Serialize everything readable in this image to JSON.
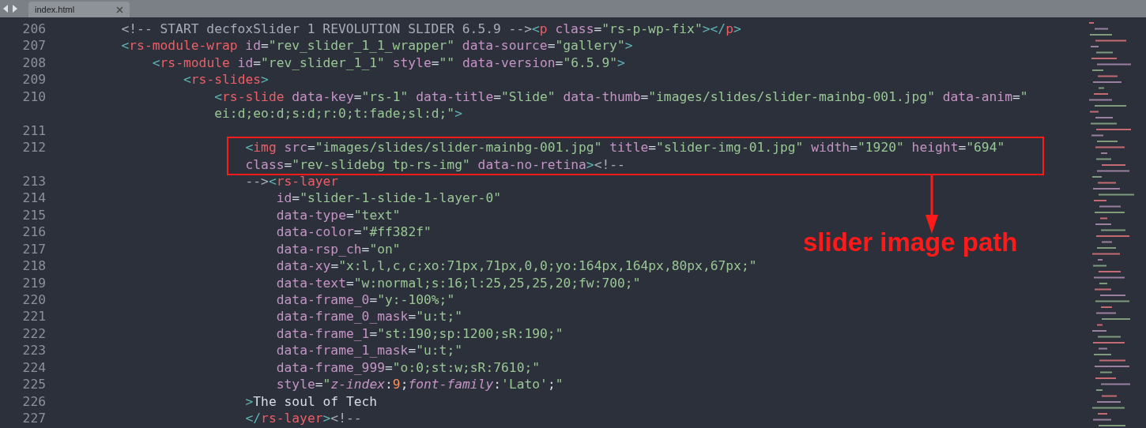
{
  "tabs": [
    {
      "label": "index.html",
      "selected": true
    }
  ],
  "lines": [
    {
      "number": "206",
      "tokens": [
        {
          "kind": "comment",
          "text": "<!-- START decfoxSlider 1 REVOLUTION SLIDER 6.5.9 -->"
        },
        {
          "kind": "punct",
          "text": "<"
        },
        {
          "kind": "tag",
          "text": "p"
        },
        {
          "kind": "attr",
          "text": " class"
        },
        {
          "kind": "plain",
          "text": "="
        },
        {
          "kind": "string",
          "text": "\"rs-p-wp-fix\""
        },
        {
          "kind": "punct",
          "text": "></"
        },
        {
          "kind": "tag",
          "text": "p"
        },
        {
          "kind": "punct",
          "text": ">"
        }
      ]
    },
    {
      "number": "207",
      "tokens": [
        {
          "kind": "punct",
          "text": "<"
        },
        {
          "kind": "tag",
          "text": "rs-module-wrap"
        },
        {
          "kind": "attr",
          "text": " id"
        },
        {
          "kind": "plain",
          "text": "="
        },
        {
          "kind": "string",
          "text": "\"rev_slider_1_1_wrapper\""
        },
        {
          "kind": "attr",
          "text": " data-source"
        },
        {
          "kind": "plain",
          "text": "="
        },
        {
          "kind": "string",
          "text": "\"gallery\""
        },
        {
          "kind": "punct",
          "text": ">"
        }
      ],
      "children": [
        {
          "number": "208",
          "tokens": [
            {
              "kind": "punct",
              "text": "<"
            },
            {
              "kind": "tag",
              "text": "rs-module"
            },
            {
              "kind": "attr",
              "text": " id"
            },
            {
              "kind": "plain",
              "text": "="
            },
            {
              "kind": "string",
              "text": "\"rev_slider_1_1\""
            },
            {
              "kind": "attr",
              "text": " style"
            },
            {
              "kind": "plain",
              "text": "="
            },
            {
              "kind": "string",
              "text": "\"\""
            },
            {
              "kind": "attr",
              "text": " data-version"
            },
            {
              "kind": "plain",
              "text": "="
            },
            {
              "kind": "string",
              "text": "\"6.5.9\""
            },
            {
              "kind": "punct",
              "text": ">"
            }
          ],
          "children": [
            {
              "number": "209",
              "tokens": [
                {
                  "kind": "punct",
                  "text": "<"
                },
                {
                  "kind": "tag",
                  "text": "rs-slides"
                },
                {
                  "kind": "punct",
                  "text": ">"
                }
              ],
              "children": [
                {
                  "number": "210",
                  "tokens": [
                    {
                      "kind": "punct",
                      "text": "<"
                    },
                    {
                      "kind": "tag",
                      "text": "rs-slide"
                    },
                    {
                      "kind": "attr",
                      "text": " data-key"
                    },
                    {
                      "kind": "plain",
                      "text": "="
                    },
                    {
                      "kind": "string",
                      "text": "\"rs-1\""
                    },
                    {
                      "kind": "attr",
                      "text": " data-title"
                    },
                    {
                      "kind": "plain",
                      "text": "="
                    },
                    {
                      "kind": "string",
                      "text": "\"Slide\""
                    },
                    {
                      "kind": "attr",
                      "text": " data-thumb"
                    },
                    {
                      "kind": "plain",
                      "text": "="
                    },
                    {
                      "kind": "string",
                      "text": "\"images/slides/slider-mainbg-001.jpg\""
                    },
                    {
                      "kind": "attr",
                      "text": " data-anim"
                    },
                    {
                      "kind": "plain",
                      "text": "="
                    },
                    {
                      "kind": "string",
                      "text": "\""
                    }
                  ],
                  "wrap": [
                    {
                      "kind": "string",
                      "text": "ei:d;eo:d;s:d;r:0;t:fade;sl:d;\""
                    },
                    {
                      "kind": "punct",
                      "text": ">"
                    }
                  ],
                  "children": [
                    {
                      "number": "211"
                    },
                    {
                      "number": "212",
                      "tokens": [
                        {
                          "kind": "punct",
                          "text": "<"
                        },
                        {
                          "kind": "tag",
                          "text": "img"
                        },
                        {
                          "kind": "attr",
                          "text": " src"
                        },
                        {
                          "kind": "plain",
                          "text": "="
                        },
                        {
                          "kind": "string",
                          "text": "\"images/slides/slider-mainbg-001.jpg\""
                        },
                        {
                          "kind": "attr",
                          "text": " title"
                        },
                        {
                          "kind": "plain",
                          "text": "="
                        },
                        {
                          "kind": "string",
                          "text": "\"slider-img-01.jpg\""
                        },
                        {
                          "kind": "attr",
                          "text": " width"
                        },
                        {
                          "kind": "plain",
                          "text": "="
                        },
                        {
                          "kind": "string",
                          "text": "\"1920\""
                        },
                        {
                          "kind": "attr",
                          "text": " height"
                        },
                        {
                          "kind": "plain",
                          "text": "="
                        },
                        {
                          "kind": "string",
                          "text": "\"694\""
                        }
                      ],
                      "wrap": [
                        {
                          "kind": "attr",
                          "text": "class"
                        },
                        {
                          "kind": "plain",
                          "text": "="
                        },
                        {
                          "kind": "string",
                          "text": "\"rev-slidebg tp-rs-img\""
                        },
                        {
                          "kind": "attr",
                          "text": " data-no-retina"
                        },
                        {
                          "kind": "punct",
                          "text": ">"
                        },
                        {
                          "kind": "comment",
                          "text": "<!--"
                        }
                      ]
                    },
                    {
                      "number": "213",
                      "tokens": [
                        {
                          "kind": "comment",
                          "text": "-->"
                        },
                        {
                          "kind": "punct",
                          "text": "<"
                        },
                        {
                          "kind": "tag",
                          "text": "rs-layer"
                        }
                      ],
                      "children": [
                        {
                          "number": "214",
                          "tokens": [
                            {
                              "kind": "attr",
                              "text": "id"
                            },
                            {
                              "kind": "plain",
                              "text": "="
                            },
                            {
                              "kind": "string",
                              "text": "\"slider-1-slide-1-layer-0\""
                            }
                          ]
                        },
                        {
                          "number": "215",
                          "tokens": [
                            {
                              "kind": "attr",
                              "text": "data-type"
                            },
                            {
                              "kind": "plain",
                              "text": "="
                            },
                            {
                              "kind": "string",
                              "text": "\"text\""
                            }
                          ]
                        },
                        {
                          "number": "216",
                          "tokens": [
                            {
                              "kind": "attr",
                              "text": "data-color"
                            },
                            {
                              "kind": "plain",
                              "text": "="
                            },
                            {
                              "kind": "string",
                              "text": "\"#ff382f\""
                            }
                          ]
                        },
                        {
                          "number": "217",
                          "tokens": [
                            {
                              "kind": "attr",
                              "text": "data-rsp_ch"
                            },
                            {
                              "kind": "plain",
                              "text": "="
                            },
                            {
                              "kind": "string",
                              "text": "\"on\""
                            }
                          ]
                        },
                        {
                          "number": "218",
                          "tokens": [
                            {
                              "kind": "attr",
                              "text": "data-xy"
                            },
                            {
                              "kind": "plain",
                              "text": "="
                            },
                            {
                              "kind": "string",
                              "text": "\"x:l,l,c,c;xo:71px,71px,0,0;yo:164px,164px,80px,67px;\""
                            }
                          ]
                        },
                        {
                          "number": "219",
                          "tokens": [
                            {
                              "kind": "attr",
                              "text": "data-text"
                            },
                            {
                              "kind": "plain",
                              "text": "="
                            },
                            {
                              "kind": "string",
                              "text": "\"w:normal;s:16;l:25,25,25,20;fw:700;\""
                            }
                          ]
                        },
                        {
                          "number": "220",
                          "tokens": [
                            {
                              "kind": "attr",
                              "text": "data-frame_0"
                            },
                            {
                              "kind": "plain",
                              "text": "="
                            },
                            {
                              "kind": "string",
                              "text": "\"y:-100%;\""
                            }
                          ]
                        },
                        {
                          "number": "221",
                          "tokens": [
                            {
                              "kind": "attr",
                              "text": "data-frame_0_mask"
                            },
                            {
                              "kind": "plain",
                              "text": "="
                            },
                            {
                              "kind": "string",
                              "text": "\"u:t;\""
                            }
                          ]
                        },
                        {
                          "number": "222",
                          "tokens": [
                            {
                              "kind": "attr",
                              "text": "data-frame_1"
                            },
                            {
                              "kind": "plain",
                              "text": "="
                            },
                            {
                              "kind": "string",
                              "text": "\"st:190;sp:1200;sR:190;\""
                            }
                          ]
                        },
                        {
                          "number": "223",
                          "tokens": [
                            {
                              "kind": "attr",
                              "text": "data-frame_1_mask"
                            },
                            {
                              "kind": "plain",
                              "text": "="
                            },
                            {
                              "kind": "string",
                              "text": "\"u:t;\""
                            }
                          ]
                        },
                        {
                          "number": "224",
                          "tokens": [
                            {
                              "kind": "attr",
                              "text": "data-frame_999"
                            },
                            {
                              "kind": "plain",
                              "text": "="
                            },
                            {
                              "kind": "string",
                              "text": "\"o:0;st:w;sR:7610;\""
                            }
                          ]
                        },
                        {
                          "number": "225",
                          "tokens": [
                            {
                              "kind": "attr",
                              "text": "style"
                            },
                            {
                              "kind": "plain",
                              "text": "="
                            },
                            {
                              "kind": "string",
                              "text": "\""
                            },
                            {
                              "kind": "prop",
                              "text": "z-index"
                            },
                            {
                              "kind": "plain",
                              "text": ":"
                            },
                            {
                              "kind": "number",
                              "text": "9"
                            },
                            {
                              "kind": "plain",
                              "text": ";"
                            },
                            {
                              "kind": "prop",
                              "text": "font-family"
                            },
                            {
                              "kind": "plain",
                              "text": ":"
                            },
                            {
                              "kind": "string",
                              "text": "'Lato'"
                            },
                            {
                              "kind": "plain",
                              "text": ";"
                            },
                            {
                              "kind": "string",
                              "text": "\""
                            }
                          ]
                        }
                      ]
                    },
                    {
                      "number": "226",
                      "tokens": [
                        {
                          "kind": "punct",
                          "text": ">"
                        },
                        {
                          "kind": "plain",
                          "text": "The soul of Tech"
                        }
                      ]
                    },
                    {
                      "number": "227",
                      "tokens": [
                        {
                          "kind": "punct",
                          "text": "</"
                        },
                        {
                          "kind": "tag",
                          "text": "rs-layer"
                        },
                        {
                          "kind": "punct",
                          "text": ">"
                        },
                        {
                          "kind": "comment",
                          "text": "<!--"
                        }
                      ]
                    }
                  ]
                }
              ]
            }
          ]
        }
      ]
    }
  ],
  "annotation": {
    "label": "slider image path"
  }
}
